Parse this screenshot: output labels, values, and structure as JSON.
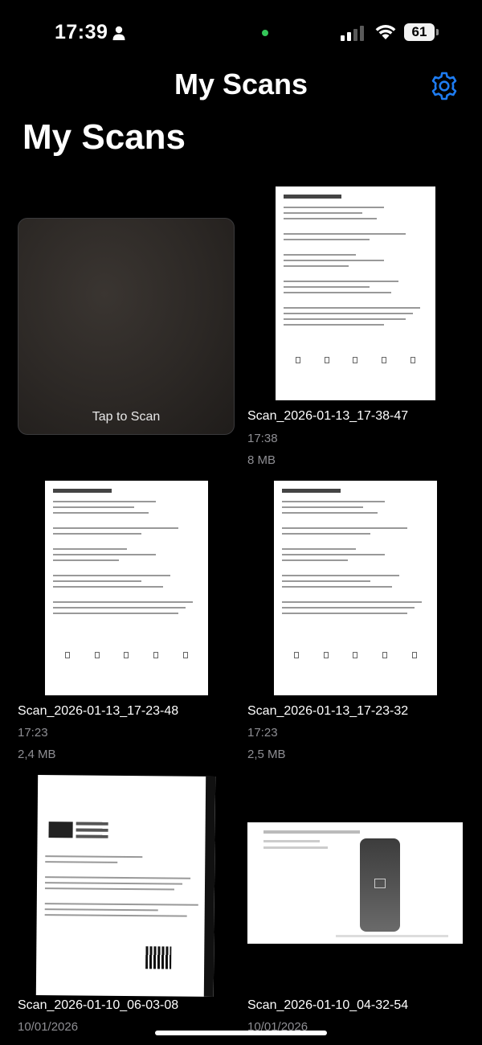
{
  "status": {
    "time": "17:39",
    "battery": "61"
  },
  "nav": {
    "title": "My Scans"
  },
  "header": {
    "large_title": "My Scans"
  },
  "tap_to_scan": {
    "label": "Tap to Scan"
  },
  "scans": [
    {
      "name": "Scan_2026-01-13_17-38-47",
      "time": "17:38",
      "size": "8 MB"
    },
    {
      "name": "Scan_2026-01-13_17-23-48",
      "time": "17:23",
      "size": "2,4 MB"
    },
    {
      "name": "Scan_2026-01-13_17-23-32",
      "time": "17:23",
      "size": "2,5 MB"
    },
    {
      "name": "Scan_2026-01-10_06-03-08",
      "time": "10/01/2026"
    },
    {
      "name": "Scan_2026-01-10_04-32-54",
      "time": "10/01/2026"
    }
  ],
  "icons": {
    "settings": "gear-icon",
    "person": "person-icon",
    "signal": "cellular-signal-icon",
    "wifi": "wifi-icon"
  },
  "colors": {
    "accent": "#1e7cf2",
    "background": "#000000",
    "secondary_text": "#8e8e93"
  }
}
